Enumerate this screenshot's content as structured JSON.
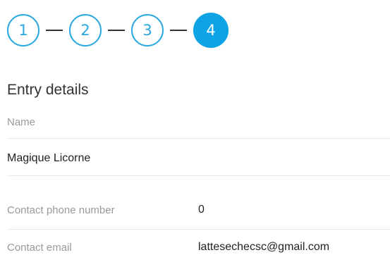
{
  "stepper": {
    "steps": [
      {
        "label": "1",
        "state": "done"
      },
      {
        "label": "2",
        "state": "done"
      },
      {
        "label": "3",
        "state": "done"
      },
      {
        "label": "4",
        "state": "active"
      }
    ],
    "colors": {
      "accent": "#0da3e4",
      "outline": "#29a8e0",
      "connector": "#333333"
    }
  },
  "section": {
    "title": "Entry details"
  },
  "fields": {
    "name": {
      "label": "Name",
      "value": "Magique Licorne"
    },
    "phone": {
      "label": "Contact phone number",
      "value": "0"
    },
    "email": {
      "label": "Contact email",
      "value": "lattesechecsc@gmail.com"
    }
  }
}
